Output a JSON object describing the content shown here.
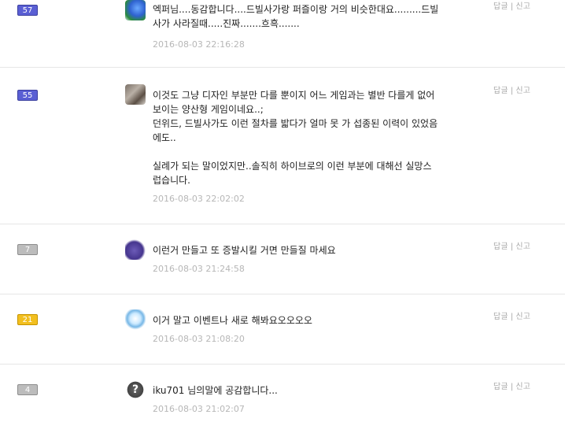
{
  "comments": [
    {
      "level": "57",
      "level_color": "#5a5fd4",
      "avatar_icon": "character-avatar-icon",
      "text": "엑퍼님....동감합니다....드빌사가랑 퍼즐이랑 거의 비슷한대요.........드빌\n사가 사라질때.....진짜.......흐흑.......",
      "timestamp": "2016-08-03 22:16:28",
      "action_reply": "답글",
      "action_report": "신고"
    },
    {
      "level": "55",
      "level_color": "#5a5fd4",
      "avatar_icon": "cat-avatar-icon",
      "text": "이것도 그냥 디자인 부분만 다를 뿐이지 어느 게임과는 별반 다를게 없어\n보이는 양산형 게임이네요..;\n던위드, 드빌사가도 이런 절차를 밟다가 얼마 못 가 섭종된 이력이 있었음\n에도..\n\n실례가 되는 말이었지만..솔직히 하이브로의 이런 부분에 대해선 실망스\n럽습니다.",
      "timestamp": "2016-08-03 22:02:02",
      "action_reply": "답글",
      "action_report": "신고"
    },
    {
      "level": "7",
      "level_color": "#bcbcbc",
      "avatar_icon": "creature-avatar-icon",
      "text": "이런거 만들고 또 증발시킬 거면 만들질 마세요",
      "timestamp": "2016-08-03 21:24:58",
      "action_reply": "답글",
      "action_report": "신고"
    },
    {
      "level": "21",
      "level_color": "#f2bf1f",
      "avatar_icon": "egg-avatar-icon",
      "text": "이거 말고 이벤트나 새로 해봐요오오오오",
      "timestamp": "2016-08-03 21:08:20",
      "action_reply": "답글",
      "action_report": "신고"
    },
    {
      "level": "4",
      "level_color": "#bcbcbc",
      "avatar_icon": "question-mark-avatar-icon",
      "text": "iku701 님의말에 공감합니다...",
      "timestamp": "2016-08-03 21:02:07",
      "action_reply": "답글",
      "action_report": "신고"
    }
  ]
}
